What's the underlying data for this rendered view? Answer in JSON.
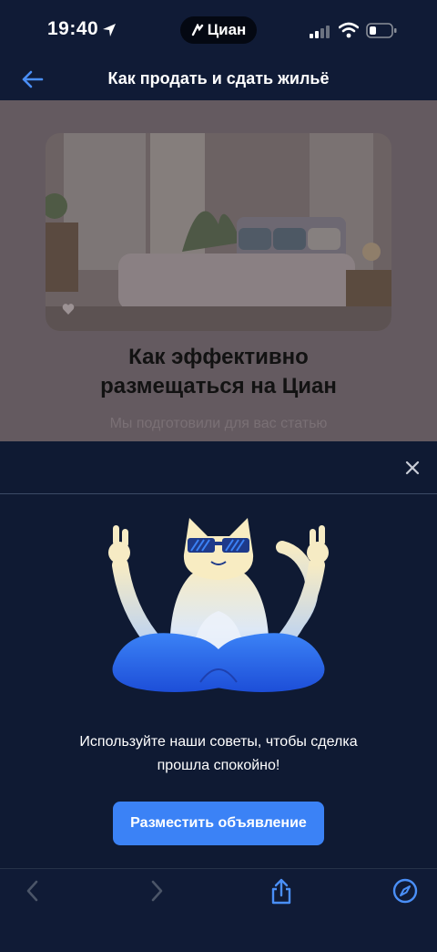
{
  "status_bar": {
    "time": "19:40",
    "app_pill": "Циан"
  },
  "nav": {
    "title": "Как продать и сдать жильё"
  },
  "article": {
    "title_line1": "Как эффективно",
    "title_line2": "размещаться на Циан",
    "subtitle": "Мы подготовили для вас статью"
  },
  "sheet": {
    "message_line1": "Используйте наши советы, чтобы сделка",
    "message_line2": "прошла спокойно!",
    "cta_label": "Разместить объявление"
  },
  "colors": {
    "accent": "#3b82f6",
    "background": "#0f1a33",
    "overlay": "#645a60"
  }
}
